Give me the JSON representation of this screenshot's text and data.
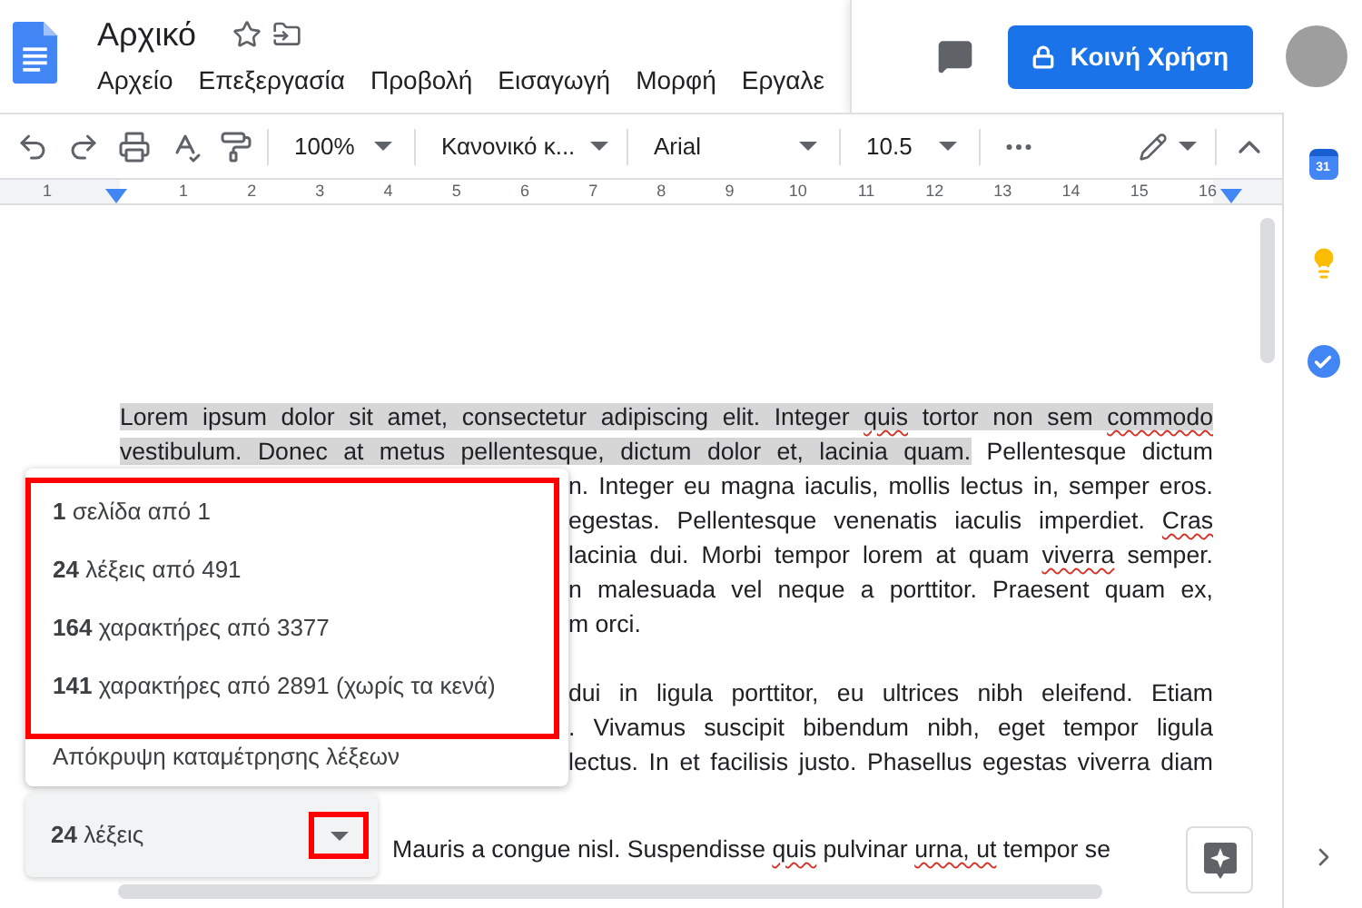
{
  "doc": {
    "title": "Αρχικό"
  },
  "menu": [
    "Αρχείο",
    "Επεξεργασία",
    "Προβολή",
    "Εισαγωγή",
    "Μορφή",
    "Εργαλε"
  ],
  "share_button": "Κοινή Χρήση",
  "toolbar": {
    "zoom": "100%",
    "style": "Κανονικό κ...",
    "font": "Arial",
    "size": "10.5"
  },
  "ruler": {
    "labels": [
      "1",
      "1",
      "2",
      "3",
      "4",
      "5",
      "6",
      "7",
      "8",
      "9",
      "10",
      "11",
      "12",
      "13",
      "14",
      "15",
      "16"
    ]
  },
  "document": {
    "top_lines": [
      {
        "segments": [
          {
            "text": "Lorem ipsum dolor sit amet, consectetur adipiscing elit. Integer ",
            "selected": true,
            "misspelled": false
          },
          {
            "text": "quis",
            "selected": true,
            "misspelled": true
          },
          {
            "text": " tortor non sem ",
            "selected": true,
            "misspelled": false
          },
          {
            "text": "commodo",
            "selected": true,
            "misspelled": true
          }
        ]
      },
      {
        "segments": [
          {
            "text": "vestibulum. Donec at metus pellentesque, dictum dolor et, lacinia quam.",
            "selected": true,
            "misspelled": false
          },
          {
            "text": " Pellentesque dictum",
            "selected": false,
            "misspelled": false
          }
        ]
      }
    ],
    "side_paragraphs": [
      [
        {
          "segments": [
            {
              "text": "n. Integer eu magna iaculis, mollis lectus in, semper eros.",
              "selected": false,
              "misspelled": false
            }
          ]
        },
        {
          "segments": [
            {
              "text": "egestas. Pellentesque venenatis iaculis imperdiet. ",
              "selected": false,
              "misspelled": false
            },
            {
              "text": "Cras",
              "selected": false,
              "misspelled": true
            }
          ]
        },
        {
          "segments": [
            {
              "text": "lacinia dui. Morbi tempor lorem at quam ",
              "selected": false,
              "misspelled": false
            },
            {
              "text": "viverra",
              "selected": false,
              "misspelled": true
            },
            {
              "text": " semper.",
              "selected": false,
              "misspelled": false
            }
          ]
        },
        {
          "segments": [
            {
              "text": "n malesuada vel neque a porttitor. Praesent quam ex,",
              "selected": false,
              "misspelled": false
            }
          ]
        },
        {
          "segments": [
            {
              "text": "m orci.",
              "selected": false,
              "misspelled": false
            }
          ]
        }
      ],
      [
        {
          "segments": [
            {
              "text": "dui in ligula porttitor, eu ultrices nibh eleifend. Etiam",
              "selected": false,
              "misspelled": false
            }
          ]
        },
        {
          "segments": [
            {
              "text": ". Vivamus suscipit bibendum nibh, eget tempor ligula",
              "selected": false,
              "misspelled": false
            }
          ]
        },
        {
          "segments": [
            {
              "text": "lectus. In et facilisis justo. Phasellus egestas viverra diam",
              "selected": false,
              "misspelled": false
            }
          ]
        }
      ]
    ],
    "bottom_lines": [
      {
        "segments": [
          {
            "text": "Mauris a congue nisl. Suspendisse ",
            "selected": false,
            "misspelled": false
          },
          {
            "text": "quis",
            "selected": false,
            "misspelled": true
          },
          {
            "text": " pulvinar ",
            "selected": false,
            "misspelled": false
          },
          {
            "text": "urna, ut",
            "selected": false,
            "misspelled": true
          },
          {
            "text": " tempor se",
            "selected": false,
            "misspelled": false
          }
        ]
      }
    ]
  },
  "word_count": {
    "summary": "**24** λέξεις",
    "expanded": true,
    "stats_highlighted": true,
    "caret_highlighted": true,
    "stats": [
      "**1** σελίδα από 1",
      "**24** λέξεις από 491",
      "**164** χαρακτήρες από 3377",
      "**141** χαρακτήρες από 2891 (χωρίς τα κενά)"
    ],
    "hide_label": "Απόκρυψη καταμέτρησης λέξεων"
  },
  "sidebar": {
    "calendar_label": "31"
  }
}
